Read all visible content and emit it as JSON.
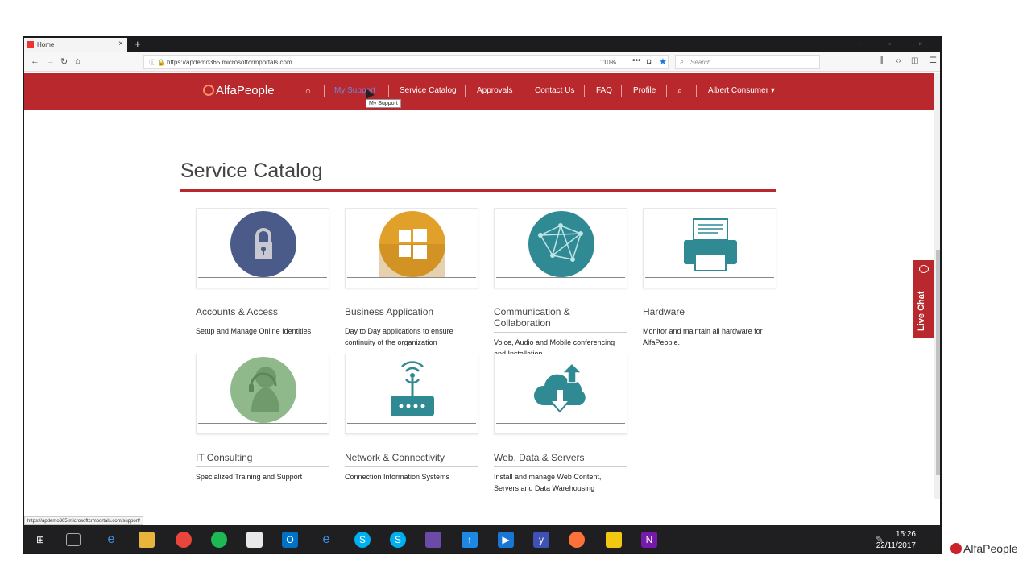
{
  "browser": {
    "tab_title": "Home",
    "new_tab": "+",
    "url": "https://apdemo365.microsoftcrmportals.com",
    "zoom": "110%",
    "search_placeholder": "Search",
    "status_url": "https://apdemo365.microsoftcrmportals.com/support/"
  },
  "site": {
    "logo": "AlfaPeople",
    "nav": {
      "my_support": "My Support",
      "service_catalog": "Service Catalog",
      "approvals": "Approvals",
      "contact_us": "Contact Us",
      "faq": "FAQ",
      "profile": "Profile",
      "user": "Albert Consumer"
    },
    "tooltip": "My Support",
    "page_title": "Service Catalog",
    "live_chat": "Live Chat",
    "cards": [
      {
        "title": "Accounts & Access",
        "desc": "Setup and Manage Online Identities",
        "color": "#4a5b8a"
      },
      {
        "title": "Business Application",
        "desc": "Day to Day applications to ensure continuity of the organization",
        "color": "#e0a02a"
      },
      {
        "title": "Communication & Collaboration",
        "desc": "Voice, Audio and Mobile conferencing and Installation",
        "color": "#2f8a93"
      },
      {
        "title": "Hardware",
        "desc": "Monitor and maintain all hardware for AlfaPeople.",
        "color": "#2f8a93"
      },
      {
        "title": "IT Consulting",
        "desc": "Specialized Training and Support",
        "color": "#8fb98b"
      },
      {
        "title": "Network & Connectivity",
        "desc": "Connection Information Systems",
        "color": "#2f8a93"
      },
      {
        "title": "Web, Data & Servers",
        "desc": "Install and manage Web Content, Servers and Data Warehousing",
        "color": "#2f8a93"
      }
    ]
  },
  "taskbar": {
    "time": "15:26",
    "date": "22/11/2017"
  },
  "watermark": "AlfaPeople"
}
